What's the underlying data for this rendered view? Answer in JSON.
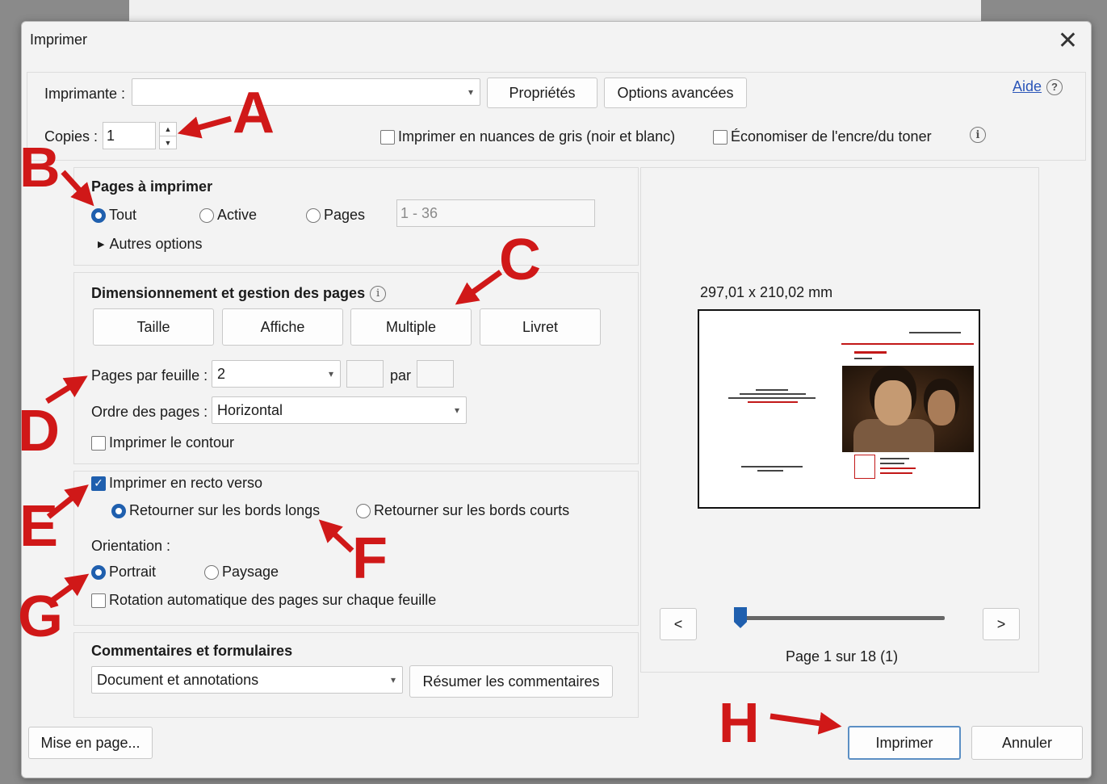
{
  "dialog": {
    "title": "Imprimer",
    "close_glyph": "✕"
  },
  "printer": {
    "label": "Imprimante :",
    "value": "",
    "properties_button": "Propriétés",
    "advanced_button": "Options avancées",
    "help_link": "Aide",
    "help_icon": "?"
  },
  "copies": {
    "label": "Copies :",
    "value": "1",
    "grayscale_label": "Imprimer en nuances de gris (noir et blanc)",
    "grayscale_checked": false,
    "save_ink_label": "Économiser de l'encre/du toner",
    "save_ink_checked": false
  },
  "pages_to_print": {
    "heading": "Pages à imprimer",
    "options": [
      "Tout",
      "Active",
      "Pages"
    ],
    "selected": "Tout",
    "range_value": "1 - 36",
    "more_options": "Autres options"
  },
  "sizing": {
    "heading": "Dimensionnement et gestion des pages",
    "buttons": [
      "Taille",
      "Affiche",
      "Multiple",
      "Livret"
    ],
    "pages_per_sheet_label": "Pages par feuille :",
    "pages_per_sheet_value": "2",
    "by_label": "par",
    "page_order_label": "Ordre des pages :",
    "page_order_value": "Horizontal",
    "print_border_label": "Imprimer le contour",
    "print_border_checked": false
  },
  "duplex": {
    "label": "Imprimer en recto verso",
    "checked": true,
    "flip_long": "Retourner sur les bords longs",
    "flip_short": "Retourner sur les bords courts",
    "selected": "long"
  },
  "orientation": {
    "label": "Orientation :",
    "portrait": "Portrait",
    "landscape": "Paysage",
    "selected": "Portrait",
    "auto_rotate_label": "Rotation automatique des pages sur chaque feuille",
    "auto_rotate_checked": false
  },
  "comments": {
    "heading": "Commentaires et formulaires",
    "value": "Document et annotations",
    "summarize_button": "Résumer les commentaires"
  },
  "preview": {
    "dimensions": "297,01 x 210,02 mm",
    "prev_button": "<",
    "next_button": ">",
    "page_status": "Page 1 sur 18 (1)",
    "slider_position": 0.0
  },
  "footer": {
    "page_setup_button": "Mise en page...",
    "print_button": "Imprimer",
    "cancel_button": "Annuler"
  },
  "annotations": [
    "A",
    "B",
    "C",
    "D",
    "E",
    "F",
    "G",
    "H"
  ],
  "colors": {
    "accent": "#1f5fae",
    "annotation": "#d01818",
    "link": "#2a55b8"
  }
}
